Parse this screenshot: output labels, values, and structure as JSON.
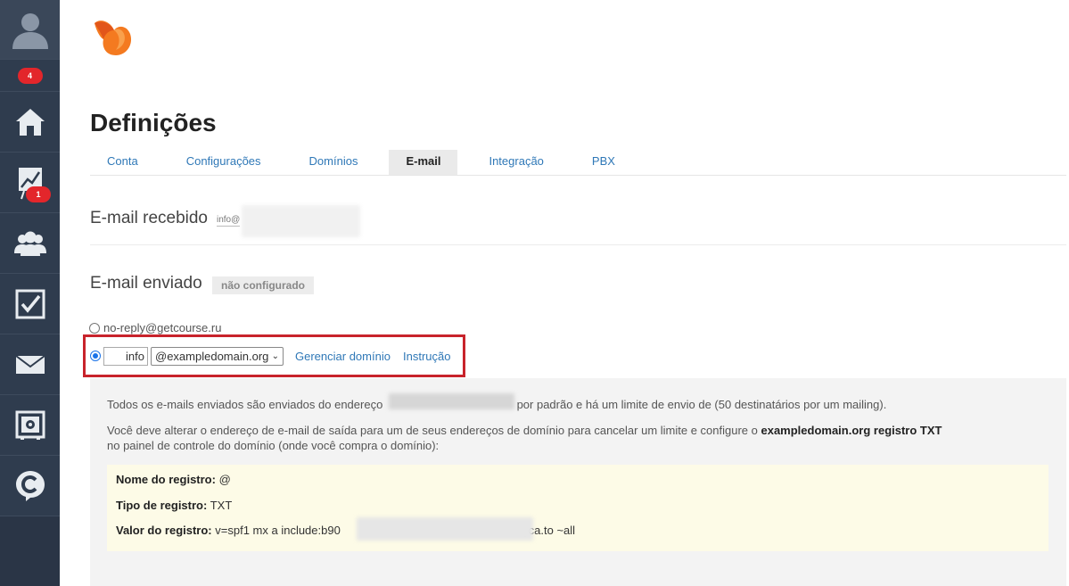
{
  "sidebar": {
    "notifications_badge": "4",
    "stats_badge": "1"
  },
  "page": {
    "title": "Definições"
  },
  "tabs": [
    {
      "label": "Conta"
    },
    {
      "label": "Configurações"
    },
    {
      "label": "Domínios"
    },
    {
      "label": "E-mail"
    },
    {
      "label": "Integração"
    },
    {
      "label": "PBX"
    }
  ],
  "received": {
    "title": "E-mail recebido",
    "value": "info@"
  },
  "sent": {
    "title": "E-mail enviado",
    "status": "não configurado",
    "option_default": "no-reply@getcourse.ru",
    "local_part": "info",
    "domain_selected": "@exampledomain.org",
    "manage_link": "Gerenciar domínio",
    "instruction_link": "Instrução"
  },
  "info": {
    "p1_before": "Todos os e-mails enviados são enviados do endereço",
    "p1_after": "por padrão e há um limite de envio de (50 destinatários por um mailing).",
    "p2_before": "Você deve alterar o endereço de e-mail de saída para um de seus endereços de domínio para cancelar um limite   e configure o ",
    "p2_bold": "exampledomain.org registro TXT",
    "p3": "no painel de controle do domínio (onde você compra o domínio):"
  },
  "record": {
    "name_label": "Nome do registro:",
    "name_value": "@",
    "type_label": "Tipo de registro:",
    "type_value": "TXT",
    "value_label": "Valor do registro:",
    "value_start": "v=spf1 mx a include:b90",
    "value_end": ".gca.to ~all"
  },
  "colors": {
    "sidebar": "#2f3c4e",
    "link": "#2f78b7",
    "badge": "#e3262b",
    "highlight": "#c8232b"
  }
}
